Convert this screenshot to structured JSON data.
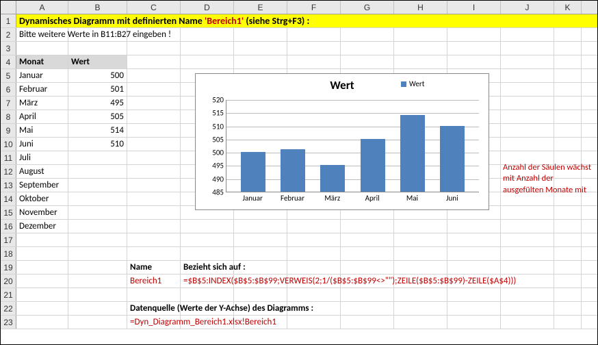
{
  "columns": [
    "A",
    "B",
    "C",
    "D",
    "E",
    "F",
    "G",
    "H",
    "I",
    "J",
    "K"
  ],
  "row_count": 23,
  "title_parts": {
    "pre": "Dynamisches Diagramm mit definierten Name ",
    "name": "'Bereich1'",
    "post": " (siehe Strg+F3) :"
  },
  "subtitle": "Bitte weitere Werte in B11:B27 eingeben !",
  "table_header": {
    "month": "Monat",
    "value": "Wert"
  },
  "months": [
    "Januar",
    "Februar",
    "März",
    "April",
    "Mai",
    "Juni",
    "Juli",
    "August",
    "September",
    "Oktober",
    "November",
    "Dezember"
  ],
  "values": [
    500,
    501,
    495,
    505,
    514,
    510,
    null,
    null,
    null,
    null,
    null,
    null
  ],
  "name_section": {
    "label_name": "Name",
    "label_ref": "Bezieht sich auf :",
    "name_value": "Bereich1",
    "ref_value": "=$B$5:INDEX($B$5:$B$99;VERWEIS(2;1/($B$5:$B$99<>\"\");ZEILE($B$5:$B$99)-ZEILE($A$4)))"
  },
  "datasource_section": {
    "label": "Datenquelle (Werte der Y-Achse) des Diagramms :",
    "value": "=Dyn_Diagramm_Bereich1.xlsx!Bereich1"
  },
  "note_text": "Anzahl der Säulen wächst mit Anzahl der ausgefülten Monate mit",
  "chart_data": {
    "type": "bar",
    "title": "Wert",
    "legend": "Wert",
    "categories": [
      "Januar",
      "Februar",
      "März",
      "April",
      "Mai",
      "Juni"
    ],
    "values": [
      500,
      501,
      495,
      505,
      514,
      510
    ],
    "ylim": [
      485,
      520
    ],
    "yticks": [
      485,
      490,
      495,
      500,
      505,
      510,
      515,
      520
    ],
    "xlabel": "",
    "ylabel": ""
  }
}
